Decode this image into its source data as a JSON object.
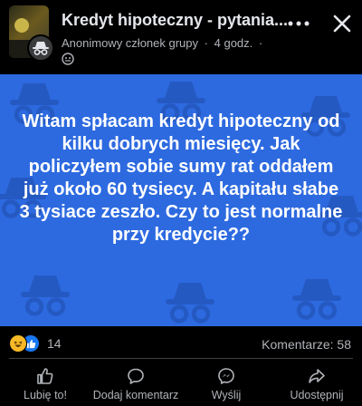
{
  "header": {
    "title": "Kredyt hipoteczny - pytania...",
    "author": "Anonimowy członek grupy",
    "separator": "·",
    "time": "4 godz.",
    "dot": "·"
  },
  "post": {
    "text": "Witam spłacam kredyt hipoteczny od kilku dobrych miesięcy. Jak policzyłem sobie sumy rat oddałem już około 60 tysiecy. A kapitału słabe 3 tysiace zeszło. Czy to jest normalne przy kredycie??",
    "background_color": "#2d6ae0"
  },
  "engagement": {
    "reaction_count": "14",
    "comments": "Komentarze: 58"
  },
  "actions": [
    {
      "label": "Lubię to!",
      "icon": "thumbs-up-icon"
    },
    {
      "label": "Dodaj komentarz",
      "icon": "comment-icon"
    },
    {
      "label": "Wyślij",
      "icon": "messenger-icon"
    },
    {
      "label": "Udostępnij",
      "icon": "share-icon"
    }
  ]
}
